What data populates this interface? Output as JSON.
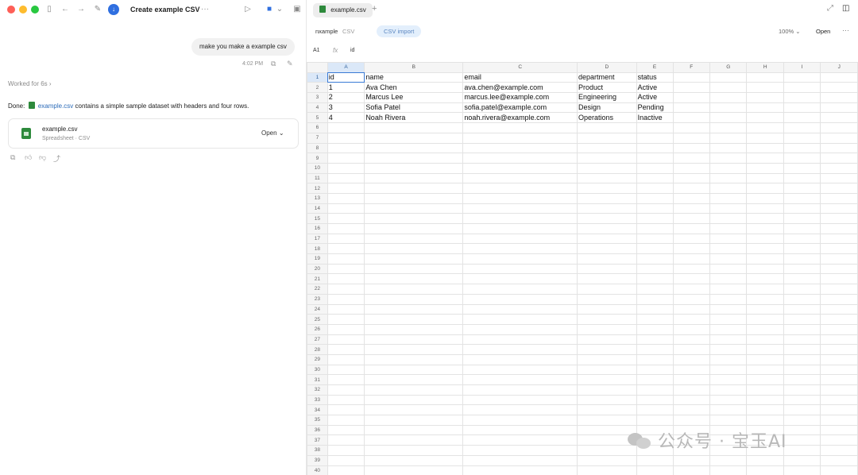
{
  "left": {
    "title": "Create example CSV",
    "icons": [
      "sidebar-icon",
      "back-icon",
      "forward-icon",
      "compose-icon",
      "download-icon",
      "more-icon",
      "play-icon",
      "app-icon",
      "chevron-down-icon",
      "terminal-icon"
    ],
    "user_message": "make you make a example csv",
    "message_time": "4:02 PM",
    "worked_for": "Worked for 6s",
    "done_prefix": "Done:",
    "done_link": "example.csv",
    "done_suffix": "contains a simple sample dataset with headers and four rows.",
    "file_card": {
      "name": "example.csv",
      "subtitle": "Spreadsheet · CSV",
      "open_label": "Open"
    }
  },
  "right": {
    "tab_label": "example.csv",
    "doc_name": "nxample",
    "doc_type": "CSV",
    "import_pill": "CSV import",
    "zoom": "100%",
    "open_label": "Open",
    "cell_ref": "A1",
    "fx_symbol": "fx",
    "formula_value": "id"
  },
  "sheet": {
    "columns": [
      "A",
      "B",
      "C",
      "D",
      "E",
      "F",
      "G",
      "H",
      "I",
      "J"
    ],
    "selected_cell": "A1",
    "row_count": 40,
    "rows": [
      [
        "id",
        "name",
        "email",
        "department",
        "status"
      ],
      [
        "1",
        "Ava Chen",
        "ava.chen@example.com",
        "Product",
        "Active"
      ],
      [
        "2",
        "Marcus Lee",
        "marcus.lee@example.com",
        "Engineering",
        "Active"
      ],
      [
        "3",
        "Sofia Patel",
        "sofia.patel@example.com",
        "Design",
        "Pending"
      ],
      [
        "4",
        "Noah Rivera",
        "noah.rivera@example.com",
        "Operations",
        "Inactive"
      ]
    ]
  },
  "watermark": "公众号 · 宝玉AI"
}
